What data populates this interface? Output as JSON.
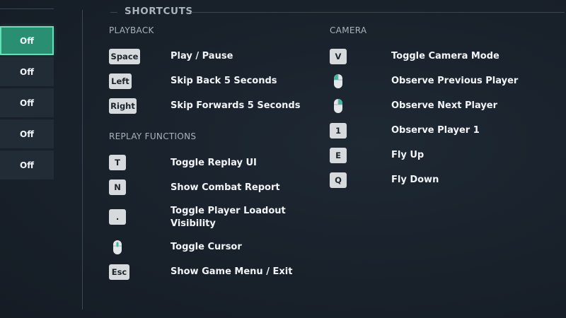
{
  "toggles": [
    {
      "label": "Off",
      "active": true
    },
    {
      "label": "Off",
      "active": false
    },
    {
      "label": "Off",
      "active": false
    },
    {
      "label": "Off",
      "active": false
    },
    {
      "label": "Off",
      "active": false
    }
  ],
  "header": {
    "title": "SHORTCUTS"
  },
  "playback": {
    "title": "PLAYBACK",
    "items": [
      {
        "key": "Space",
        "action": "Play / Pause"
      },
      {
        "key": "Left",
        "action": "Skip Back 5 Seconds"
      },
      {
        "key": "Right",
        "action": "Skip Forwards 5 Seconds"
      }
    ]
  },
  "replay": {
    "title": "REPLAY FUNCTIONS",
    "items": [
      {
        "key": "T",
        "action": "Toggle Replay UI"
      },
      {
        "key": "N",
        "action": "Show Combat Report"
      },
      {
        "key": ".",
        "action_line1": "Toggle Player Loadout",
        "action_line2": "Visibility"
      },
      {
        "icon": "mouse-middle-icon",
        "action": "Toggle Cursor"
      },
      {
        "key": "Esc",
        "action": "Show Game Menu / Exit"
      }
    ]
  },
  "camera": {
    "title": "CAMERA",
    "items": [
      {
        "key": "V",
        "action": "Toggle Camera Mode"
      },
      {
        "icon": "mouse-left-icon",
        "action": "Observe Previous Player"
      },
      {
        "icon": "mouse-right-icon",
        "action": "Observe Next Player"
      },
      {
        "key": "1",
        "action": "Observe Player 1"
      },
      {
        "key": "E",
        "action": "Fly Up"
      },
      {
        "key": "Q",
        "action": "Fly Down"
      }
    ]
  },
  "colors": {
    "accent": "#2a8f72",
    "accent_border": "#5fe3b6",
    "key_bg": "#d6dadd",
    "mouse_accent": "#3fb8a0"
  }
}
